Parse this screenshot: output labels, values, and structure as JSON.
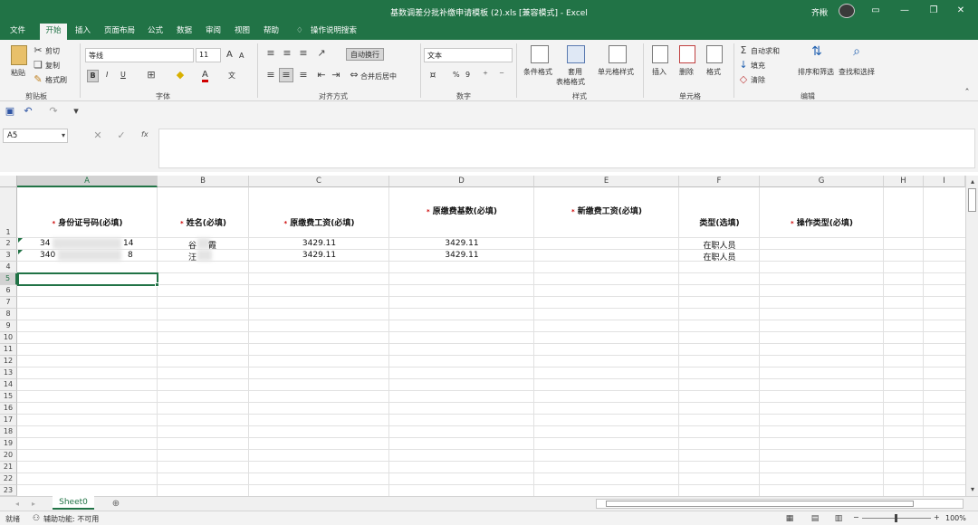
{
  "window": {
    "title": "基数调差分批补缴申请模板 (2).xls  [兼容模式]  -  Excel",
    "user": "齐楸"
  },
  "menu": {
    "tabs": [
      "文件",
      "开始",
      "插入",
      "页面布局",
      "公式",
      "数据",
      "审阅",
      "视图",
      "帮助"
    ],
    "active": "开始",
    "tell_me": "操作说明搜索"
  },
  "ribbon": {
    "clipboard": {
      "paste": "粘贴",
      "cut": "剪切",
      "copy": "复制",
      "format_painter": "格式刷",
      "group": "剪贴板"
    },
    "font": {
      "name": "等线",
      "size": "11",
      "bold": "B",
      "italic": "I",
      "underline": "U",
      "grow": "A",
      "shrink": "A",
      "font_color": "A",
      "phonetic": "文",
      "group": "字体"
    },
    "alignment": {
      "wrap": "自动换行",
      "merge": "合并后居中",
      "group": "对齐方式"
    },
    "number": {
      "format": "文本",
      "percent": "%",
      "comma": "9",
      "group": "数字"
    },
    "styles": {
      "conditional": "条件格式",
      "table_line1": "套用",
      "table_line2": "表格格式",
      "cell_styles": "单元格样式",
      "group": "样式"
    },
    "cells": {
      "insert": "插入",
      "delete": "删除",
      "format": "格式",
      "group": "单元格"
    },
    "editing": {
      "autosum": "自动求和",
      "fill": "填充",
      "clear": "清除",
      "sort": "排序和筛选",
      "find": "查找和选择",
      "group": "编辑"
    }
  },
  "formula_bar": {
    "name_box": "A5",
    "fx": "fx",
    "value": ""
  },
  "sheet": {
    "columns": [
      "A",
      "B",
      "C",
      "D",
      "E",
      "F",
      "G",
      "H",
      "I"
    ],
    "rows": [
      "1",
      "2",
      "3",
      "4",
      "5",
      "6",
      "7",
      "8",
      "9",
      "10",
      "11",
      "12",
      "13",
      "14",
      "15",
      "16",
      "17",
      "18",
      "19",
      "20",
      "21",
      "22",
      "23"
    ],
    "headers": {
      "A": "身份证号码(必填)",
      "B": "姓名(必填)",
      "C": "原缴费工资(必填)",
      "D": "原缴费基数(必填)",
      "E": "新缴费工资(必填)",
      "F": "类型(选填)",
      "G": "操作类型(必填)"
    },
    "header_mark": "*",
    "row2": {
      "A_start": "34",
      "A_end": "14",
      "B_start": "谷",
      "B_end": "霞",
      "C": "3429.11",
      "D": "3429.11",
      "F": "在职人员"
    },
    "row3": {
      "A_start": "340",
      "A_end": "8",
      "B_start": "汪",
      "C": "3429.11",
      "D": "3429.11",
      "F": "在职人员"
    }
  },
  "sheet_tabs": [
    "Sheet0"
  ],
  "status": {
    "ready": "就绪",
    "accessibility": "辅助功能: 不可用",
    "zoom": "100%"
  }
}
